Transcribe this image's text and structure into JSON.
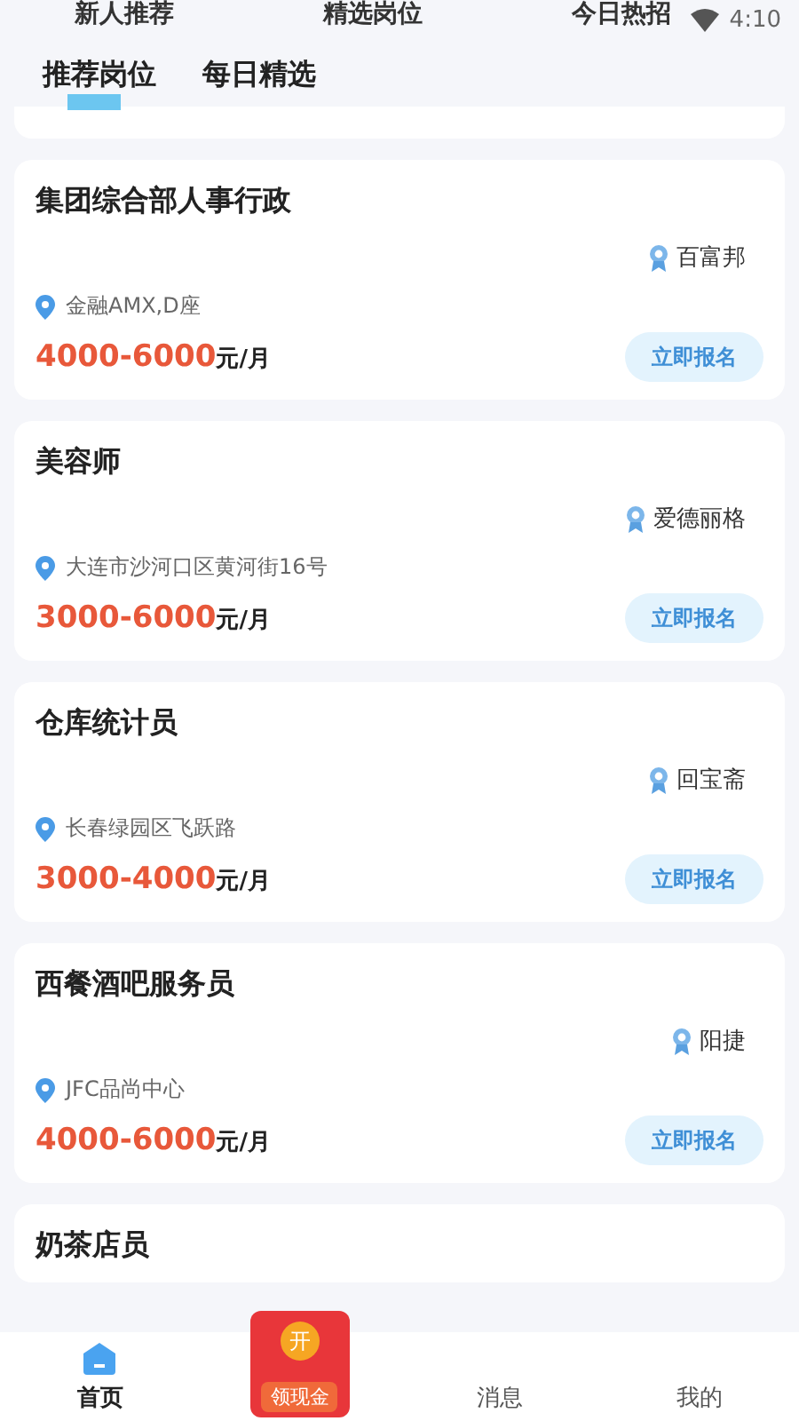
{
  "status_bar": {
    "time": "4:10"
  },
  "top_tabs": [
    {
      "label": "新人推荐",
      "selected": false
    },
    {
      "label": "精选岗位",
      "selected": false
    },
    {
      "label": "今日热招",
      "selected": false
    }
  ],
  "sub_tabs": [
    {
      "label": "推荐岗位",
      "selected": true
    },
    {
      "label": "每日精选",
      "selected": false
    }
  ],
  "jobs": [
    {
      "title": "集团综合部人事行政",
      "company": "百富邦",
      "location": "金融AMX,D座",
      "salary": "4000-6000",
      "unit": "元/月",
      "action": "立即报名"
    },
    {
      "title": "美容师",
      "company": "爱德丽格",
      "location": "大连市沙河口区黄河街16号",
      "salary": "3000-6000",
      "unit": "元/月",
      "action": "立即报名"
    },
    {
      "title": "仓库统计员",
      "company": "回宝斋",
      "location": "长春绿园区飞跃路",
      "salary": "3000-4000",
      "unit": "元/月",
      "action": "立即报名"
    },
    {
      "title": "西餐酒吧服务员",
      "company": "阳捷",
      "location": "JFC品尚中心",
      "salary": "4000-6000",
      "unit": "元/月",
      "action": "立即报名"
    },
    {
      "title": "奶茶店员"
    }
  ],
  "bottom_nav": [
    {
      "kind": "tab",
      "label": "首页",
      "selected": true
    },
    {
      "kind": "promo",
      "label": "领现金",
      "badge": "开"
    },
    {
      "kind": "tab",
      "label": "消息",
      "selected": false
    },
    {
      "kind": "tab",
      "label": "我的",
      "selected": false
    }
  ]
}
